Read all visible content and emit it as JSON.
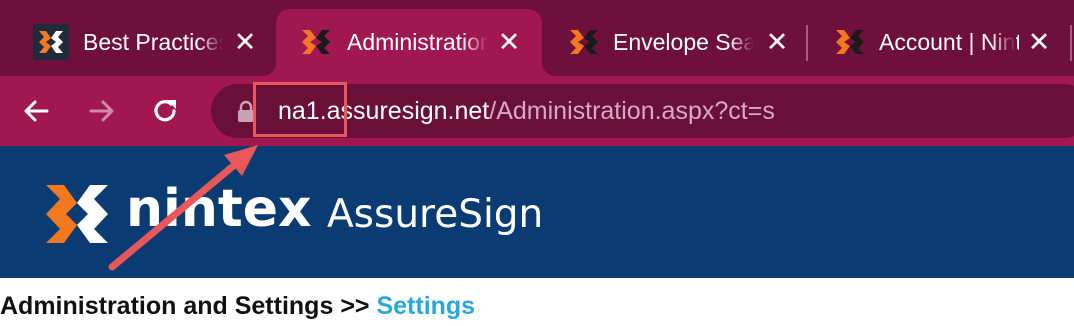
{
  "browser": {
    "tabs": [
      {
        "title": "Best Practices",
        "favicon": "nintex-dark-icon",
        "active": false
      },
      {
        "title": "Administration",
        "favicon": "nintex-icon",
        "active": true
      },
      {
        "title": "Envelope Search",
        "favicon": "nintex-icon",
        "active": false
      },
      {
        "title": "Account | Nintex",
        "favicon": "nintex-icon",
        "active": false
      }
    ],
    "close_icon": "close-icon",
    "nav": {
      "back": "back-arrow-icon",
      "forward": "forward-arrow-icon",
      "reload": "reload-icon"
    },
    "address": {
      "host": "na1.assuresign.net",
      "path": "/Administration.aspx?ct=s",
      "lock_icon": "lock-icon"
    }
  },
  "header": {
    "brand": "nintex",
    "product": "AssureSign",
    "logo_icon": "nintex-logo-icon"
  },
  "breadcrumb": {
    "current": "Administration and Settings",
    "separator": ">>",
    "next": "Settings"
  },
  "annotation": {
    "highlight_color": "#e8585a",
    "arrow_color": "#e8585a"
  },
  "colors": {
    "tab_strip": "#6f0f3b",
    "toolbar": "#a1174f",
    "banner": "#0a3b72",
    "nintex_orange": "#f4781f"
  }
}
